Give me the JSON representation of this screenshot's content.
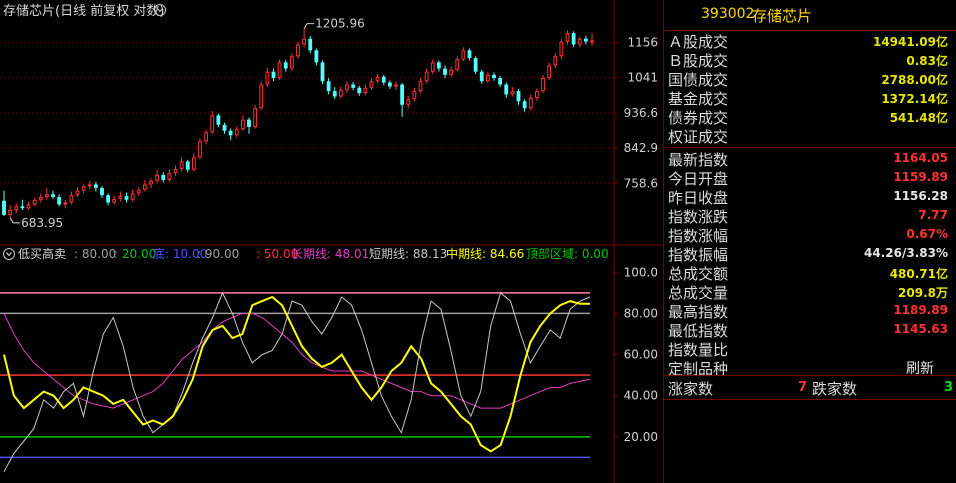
{
  "main_panel": {
    "title": "存储芯片(日线 前复权 对数)",
    "high_marker": "1205.96",
    "low_marker": "683.95"
  },
  "indicator_panel": {
    "name": "低买高卖",
    "params": [
      {
        "text": ": 80.00",
        "color": "#a0a0a0"
      },
      {
        "text": ": 20.00",
        "color": "#00c800"
      },
      {
        "text": "底: 10.00",
        "color": "#5050ff"
      },
      {
        "text": ": 90.00",
        "color": "#a0a0a0"
      },
      {
        "text": ": 50.00",
        "color": "#ff3232"
      },
      {
        "text": "长期线: 48.01",
        "color": "#e040c0"
      },
      {
        "text": "短期线: 88.13",
        "color": "#c8c8c8"
      },
      {
        "text": "中期线: 84.66",
        "color": "#ffff00"
      },
      {
        "text": "顶部区域: 0.00",
        "color": "#00c800"
      }
    ]
  },
  "colors": {
    "up": "#ff3232",
    "down": "#54ffff",
    "grid": "#7a0000",
    "axis_label": "#d0d0d0",
    "short_line": "#c8c8c8",
    "mid_line": "#ffff00",
    "long_line": "#e040c0"
  },
  "chart_data": [
    {
      "type": "candlestick",
      "title": "存储芯片(日线 前复权 对数)",
      "yscale": "log",
      "ylim": [
        640,
        1260
      ],
      "yticks": [
        "1156",
        "1041",
        "936.6",
        "842.9",
        "758.6"
      ],
      "annotations": [
        "1205.96",
        "683.95"
      ],
      "candles": [
        {
          "o": 720,
          "c": 690,
          "h": 742,
          "l": 688
        },
        {
          "o": 690,
          "c": 700,
          "h": 710,
          "l": 684
        },
        {
          "o": 700,
          "c": 708,
          "h": 714,
          "l": 694
        },
        {
          "o": 708,
          "c": 704,
          "h": 722,
          "l": 700
        },
        {
          "o": 704,
          "c": 712,
          "h": 718,
          "l": 700
        },
        {
          "o": 712,
          "c": 722,
          "h": 726,
          "l": 708
        },
        {
          "o": 722,
          "c": 728,
          "h": 736,
          "l": 716
        },
        {
          "o": 728,
          "c": 734,
          "h": 748,
          "l": 722
        },
        {
          "o": 734,
          "c": 728,
          "h": 742,
          "l": 724
        },
        {
          "o": 728,
          "c": 712,
          "h": 734,
          "l": 708
        },
        {
          "o": 712,
          "c": 716,
          "h": 722,
          "l": 704
        },
        {
          "o": 716,
          "c": 732,
          "h": 740,
          "l": 712
        },
        {
          "o": 732,
          "c": 742,
          "h": 750,
          "l": 728
        },
        {
          "o": 742,
          "c": 752,
          "h": 756,
          "l": 736
        },
        {
          "o": 752,
          "c": 756,
          "h": 764,
          "l": 744
        },
        {
          "o": 756,
          "c": 748,
          "h": 762,
          "l": 740
        },
        {
          "o": 748,
          "c": 732,
          "h": 752,
          "l": 726
        },
        {
          "o": 732,
          "c": 716,
          "h": 736,
          "l": 710
        },
        {
          "o": 716,
          "c": 724,
          "h": 730,
          "l": 712
        },
        {
          "o": 724,
          "c": 730,
          "h": 740,
          "l": 718
        },
        {
          "o": 730,
          "c": 722,
          "h": 738,
          "l": 716
        },
        {
          "o": 722,
          "c": 736,
          "h": 744,
          "l": 718
        },
        {
          "o": 736,
          "c": 744,
          "h": 750,
          "l": 730
        },
        {
          "o": 744,
          "c": 756,
          "h": 766,
          "l": 740
        },
        {
          "o": 756,
          "c": 764,
          "h": 770,
          "l": 748
        },
        {
          "o": 764,
          "c": 778,
          "h": 790,
          "l": 758
        },
        {
          "o": 778,
          "c": 766,
          "h": 784,
          "l": 760
        },
        {
          "o": 766,
          "c": 782,
          "h": 792,
          "l": 762
        },
        {
          "o": 782,
          "c": 792,
          "h": 800,
          "l": 776
        },
        {
          "o": 792,
          "c": 810,
          "h": 820,
          "l": 786
        },
        {
          "o": 810,
          "c": 790,
          "h": 814,
          "l": 784
        },
        {
          "o": 790,
          "c": 820,
          "h": 830,
          "l": 786
        },
        {
          "o": 820,
          "c": 860,
          "h": 868,
          "l": 816
        },
        {
          "o": 860,
          "c": 884,
          "h": 890,
          "l": 852
        },
        {
          "o": 884,
          "c": 930,
          "h": 942,
          "l": 880
        },
        {
          "o": 930,
          "c": 904,
          "h": 936,
          "l": 898
        },
        {
          "o": 904,
          "c": 888,
          "h": 910,
          "l": 880
        },
        {
          "o": 888,
          "c": 876,
          "h": 894,
          "l": 864
        },
        {
          "o": 876,
          "c": 892,
          "h": 900,
          "l": 870
        },
        {
          "o": 892,
          "c": 918,
          "h": 930,
          "l": 888
        },
        {
          "o": 918,
          "c": 898,
          "h": 924,
          "l": 880
        },
        {
          "o": 898,
          "c": 950,
          "h": 960,
          "l": 894
        },
        {
          "o": 950,
          "c": 1020,
          "h": 1030,
          "l": 946
        },
        {
          "o": 1020,
          "c": 1060,
          "h": 1072,
          "l": 1012
        },
        {
          "o": 1060,
          "c": 1040,
          "h": 1070,
          "l": 1030
        },
        {
          "o": 1040,
          "c": 1090,
          "h": 1100,
          "l": 1034
        },
        {
          "o": 1090,
          "c": 1070,
          "h": 1098,
          "l": 1060
        },
        {
          "o": 1070,
          "c": 1110,
          "h": 1120,
          "l": 1062
        },
        {
          "o": 1110,
          "c": 1150,
          "h": 1160,
          "l": 1102
        },
        {
          "o": 1150,
          "c": 1170,
          "h": 1206,
          "l": 1140
        },
        {
          "o": 1170,
          "c": 1130,
          "h": 1180,
          "l": 1120
        },
        {
          "o": 1130,
          "c": 1090,
          "h": 1136,
          "l": 1080
        },
        {
          "o": 1090,
          "c": 1030,
          "h": 1096,
          "l": 1022
        },
        {
          "o": 1030,
          "c": 1000,
          "h": 1040,
          "l": 990
        },
        {
          "o": 1000,
          "c": 984,
          "h": 1012,
          "l": 976
        },
        {
          "o": 984,
          "c": 1004,
          "h": 1014,
          "l": 978
        },
        {
          "o": 1004,
          "c": 1020,
          "h": 1030,
          "l": 996
        },
        {
          "o": 1020,
          "c": 1010,
          "h": 1028,
          "l": 1002
        },
        {
          "o": 1010,
          "c": 994,
          "h": 1016,
          "l": 986
        },
        {
          "o": 994,
          "c": 1010,
          "h": 1020,
          "l": 988
        },
        {
          "o": 1010,
          "c": 1030,
          "h": 1040,
          "l": 1004
        },
        {
          "o": 1030,
          "c": 1044,
          "h": 1052,
          "l": 1024
        },
        {
          "o": 1044,
          "c": 1026,
          "h": 1050,
          "l": 1018
        },
        {
          "o": 1026,
          "c": 1014,
          "h": 1032,
          "l": 1006
        },
        {
          "o": 1014,
          "c": 1020,
          "h": 1028,
          "l": 1004
        },
        {
          "o": 1020,
          "c": 960,
          "h": 1024,
          "l": 926
        },
        {
          "o": 960,
          "c": 976,
          "h": 986,
          "l": 950
        },
        {
          "o": 976,
          "c": 1000,
          "h": 1010,
          "l": 970
        },
        {
          "o": 1000,
          "c": 1030,
          "h": 1040,
          "l": 994
        },
        {
          "o": 1030,
          "c": 1060,
          "h": 1070,
          "l": 1024
        },
        {
          "o": 1060,
          "c": 1090,
          "h": 1100,
          "l": 1052
        },
        {
          "o": 1090,
          "c": 1070,
          "h": 1096,
          "l": 1060
        },
        {
          "o": 1070,
          "c": 1050,
          "h": 1080,
          "l": 1040
        },
        {
          "o": 1050,
          "c": 1066,
          "h": 1076,
          "l": 1044
        },
        {
          "o": 1066,
          "c": 1100,
          "h": 1110,
          "l": 1060
        },
        {
          "o": 1100,
          "c": 1130,
          "h": 1140,
          "l": 1094
        },
        {
          "o": 1130,
          "c": 1104,
          "h": 1136,
          "l": 1096
        },
        {
          "o": 1104,
          "c": 1060,
          "h": 1110,
          "l": 1052
        },
        {
          "o": 1060,
          "c": 1030,
          "h": 1066,
          "l": 1022
        },
        {
          "o": 1030,
          "c": 1050,
          "h": 1060,
          "l": 1024
        },
        {
          "o": 1050,
          "c": 1040,
          "h": 1058,
          "l": 1032
        },
        {
          "o": 1040,
          "c": 1020,
          "h": 1046,
          "l": 1012
        },
        {
          "o": 1020,
          "c": 990,
          "h": 1026,
          "l": 980
        },
        {
          "o": 990,
          "c": 1000,
          "h": 1012,
          "l": 984
        },
        {
          "o": 1000,
          "c": 970,
          "h": 1006,
          "l": 960
        },
        {
          "o": 970,
          "c": 950,
          "h": 976,
          "l": 940
        },
        {
          "o": 950,
          "c": 980,
          "h": 990,
          "l": 944
        },
        {
          "o": 980,
          "c": 1000,
          "h": 1008,
          "l": 972
        },
        {
          "o": 1000,
          "c": 1040,
          "h": 1050,
          "l": 994
        },
        {
          "o": 1040,
          "c": 1080,
          "h": 1090,
          "l": 1034
        },
        {
          "o": 1080,
          "c": 1110,
          "h": 1120,
          "l": 1072
        },
        {
          "o": 1110,
          "c": 1160,
          "h": 1168,
          "l": 1100
        },
        {
          "o": 1160,
          "c": 1190,
          "h": 1200,
          "l": 1150
        },
        {
          "o": 1190,
          "c": 1150,
          "h": 1196,
          "l": 1140
        },
        {
          "o": 1150,
          "c": 1170,
          "h": 1176,
          "l": 1140
        },
        {
          "o": 1170,
          "c": 1160,
          "h": 1180,
          "l": 1150
        },
        {
          "o": 1159.89,
          "c": 1164.05,
          "h": 1189.89,
          "l": 1145.63
        }
      ]
    },
    {
      "type": "line",
      "title": "低买高卖",
      "ylim": [
        0,
        105
      ],
      "yticks": [
        "100.0",
        "80.00",
        "60.00",
        "40.00",
        "20.00"
      ],
      "reference_lines": [
        {
          "value": 90,
          "color": "#ff80a0"
        },
        {
          "value": 80,
          "color": "#a0a0a0"
        },
        {
          "value": 50,
          "color": "#ff3232"
        },
        {
          "value": 20,
          "color": "#00c800"
        },
        {
          "value": 10,
          "color": "#5050ff"
        }
      ],
      "series": [
        {
          "name": "短期线",
          "color": "#c8c8c8",
          "values": [
            3,
            12,
            18,
            24,
            38,
            34,
            42,
            46,
            30,
            52,
            70,
            78,
            64,
            44,
            30,
            22,
            26,
            30,
            42,
            56,
            68,
            78,
            90,
            80,
            66,
            56,
            60,
            62,
            70,
            86,
            84,
            76,
            70,
            78,
            88,
            84,
            72,
            56,
            40,
            30,
            22,
            38,
            66,
            86,
            82,
            62,
            40,
            30,
            42,
            74,
            90,
            86,
            70,
            56,
            64,
            72,
            68,
            82,
            86,
            88
          ]
        },
        {
          "name": "中期线",
          "color": "#ffff00",
          "values": [
            60,
            40,
            34,
            38,
            42,
            40,
            34,
            38,
            44,
            42,
            40,
            36,
            38,
            32,
            26,
            28,
            26,
            30,
            38,
            48,
            64,
            72,
            74,
            68,
            70,
            84,
            86,
            88,
            84,
            74,
            64,
            58,
            54,
            56,
            60,
            52,
            44,
            38,
            44,
            52,
            56,
            64,
            58,
            46,
            42,
            36,
            30,
            26,
            16,
            13,
            16,
            30,
            50,
            66,
            74,
            80,
            84,
            86,
            84.66,
            84.66
          ]
        },
        {
          "name": "长期线",
          "color": "#e040c0",
          "values": [
            80,
            70,
            62,
            56,
            52,
            48,
            44,
            40,
            38,
            36,
            35,
            34,
            36,
            38,
            40,
            42,
            46,
            52,
            58,
            62,
            66,
            72,
            76,
            78,
            80,
            80,
            78,
            74,
            70,
            66,
            60,
            56,
            54,
            52,
            52,
            52,
            52,
            50,
            48,
            46,
            44,
            42,
            42,
            40,
            40,
            40,
            38,
            36,
            34,
            34,
            34,
            36,
            38,
            40,
            42,
            44,
            44,
            46,
            47,
            48.01
          ]
        }
      ]
    }
  ],
  "info_panel": {
    "code": "393002",
    "name": "存储芯片",
    "rows": [
      {
        "label": "Ａ股成交",
        "value": "14941.09亿",
        "color": "yellow"
      },
      {
        "label": "Ｂ股成交",
        "value": "0.83亿",
        "color": "yellow"
      },
      {
        "label": "国债成交",
        "value": "2788.00亿",
        "color": "yellow"
      },
      {
        "label": "基金成交",
        "value": "1372.14亿",
        "color": "yellow"
      },
      {
        "label": "债券成交",
        "value": "541.48亿",
        "color": "yellow"
      },
      {
        "label": "权证成交",
        "value": "",
        "color": "yellow"
      },
      {
        "label": "最新指数",
        "value": "1164.05",
        "color": "red"
      },
      {
        "label": "今日开盘",
        "value": "1159.89",
        "color": "red"
      },
      {
        "label": "昨日收盘",
        "value": "1156.28",
        "color": "white"
      },
      {
        "label": "指数涨跌",
        "value": "7.77",
        "color": "red"
      },
      {
        "label": "指数涨幅",
        "value": "0.67%",
        "color": "red"
      },
      {
        "label": "指数振幅",
        "value": "44.26/3.83%",
        "color": "white"
      },
      {
        "label": "总成交额",
        "value": "480.71亿",
        "color": "yellow"
      },
      {
        "label": "总成交量",
        "value": "209.8万",
        "color": "yellow"
      },
      {
        "label": "最高指数",
        "value": "1189.89",
        "color": "red"
      },
      {
        "label": "最低指数",
        "value": "1145.63",
        "color": "red"
      },
      {
        "label": "指数量比",
        "value": "",
        "color": "white"
      },
      {
        "label": "定制品种",
        "value": "刷新",
        "color": "white"
      }
    ],
    "stats": {
      "up_label": "涨家数",
      "up_value": "7",
      "down_label": "跌家数",
      "down_value": "3"
    }
  }
}
